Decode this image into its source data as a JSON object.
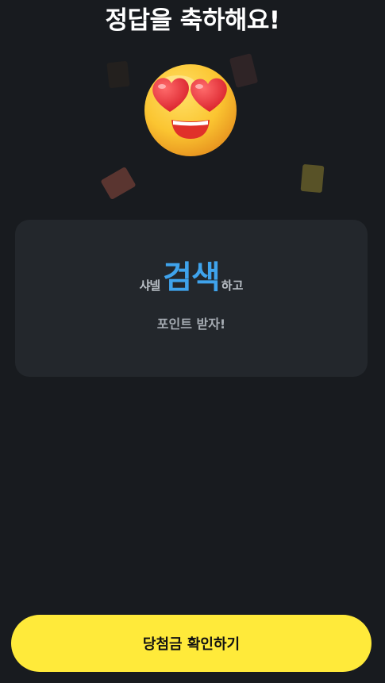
{
  "header": {
    "title": "정답을 축하해요!"
  },
  "hero": {
    "icon": "heart-eyes-face-icon"
  },
  "card": {
    "prefix": "샤넬",
    "keyword": "검색",
    "suffix": "하고",
    "subtext": "포인트 받자!"
  },
  "footer": {
    "button_label": "당첨금 확인하기"
  },
  "colors": {
    "background": "#181b1f",
    "card": "#23272c",
    "accent_blue": "#3fa3ec",
    "button_yellow": "#ffea3a"
  }
}
